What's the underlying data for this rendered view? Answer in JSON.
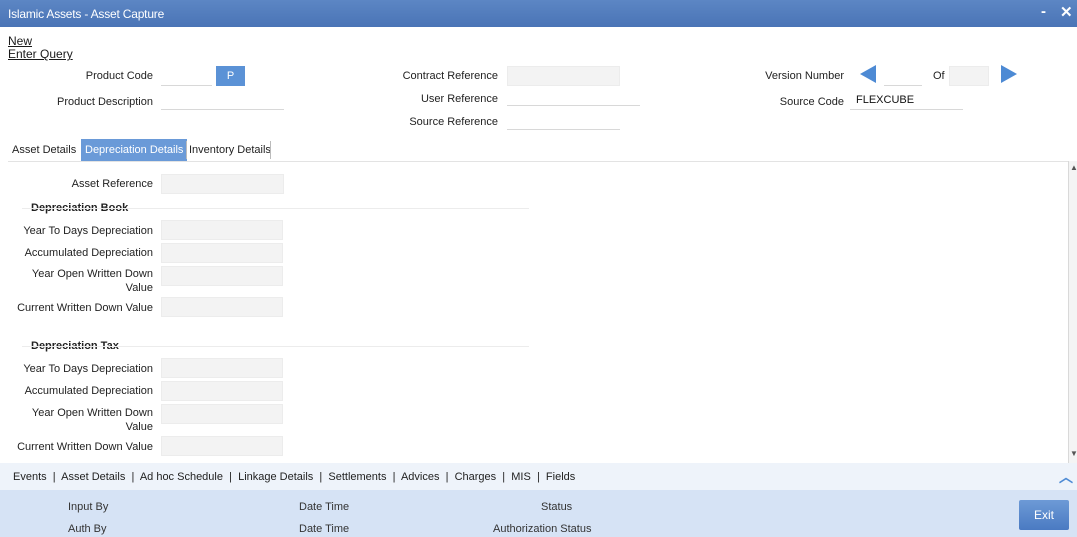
{
  "window": {
    "title": "Islamic Assets - Asset Capture",
    "minimize": "-",
    "close": "✕"
  },
  "menu": {
    "new": "New",
    "enter_query": "Enter Query"
  },
  "header": {
    "product_code_label": "Product Code",
    "product_code_value": "",
    "p_button": "P",
    "product_description_label": "Product Description",
    "product_description_value": "",
    "contract_reference_label": "Contract Reference",
    "contract_reference_value": "",
    "user_reference_label": "User Reference",
    "user_reference_value": "",
    "source_reference_label": "Source Reference",
    "source_reference_value": "",
    "version_number_label": "Version Number",
    "version_number_value": "",
    "of_label": "Of",
    "of_value": "",
    "source_code_label": "Source Code",
    "source_code_value": "FLEXCUBE"
  },
  "tabs": [
    {
      "label": "Asset Details",
      "active": false
    },
    {
      "label": "Depreciation Details",
      "active": true
    },
    {
      "label": "Inventory Details",
      "active": false
    }
  ],
  "depreciation": {
    "asset_reference_label": "Asset Reference",
    "book": {
      "title": "Depreciation Book",
      "ytd_label": "Year To Days Depreciation",
      "accum_label": "Accumulated Depreciation",
      "yowdv_label_1": "Year Open Written Down",
      "yowdv_label_2": "Value",
      "cwdv_label": "Current Written Down Value"
    },
    "tax": {
      "title": "Depreciation Tax",
      "ytd_label": "Year To Days Depreciation",
      "accum_label": "Accumulated Depreciation",
      "yowdv_label_1": "Year Open Written Down",
      "yowdv_label_2": "Value",
      "cwdv_label": "Current Written Down Value"
    }
  },
  "bottom_links": [
    "Events",
    "Asset Details",
    "Ad hoc Schedule",
    "Linkage Details",
    "Settlements",
    "Advices",
    "Charges",
    "MIS",
    "Fields"
  ],
  "footer": {
    "input_by": "Input By",
    "auth_by": "Auth By",
    "date_time_1": "Date Time",
    "date_time_2": "Date Time",
    "status": "Status",
    "authorization_status": "Authorization Status",
    "exit": "Exit"
  },
  "colors": {
    "titlebar": "#4f79ba",
    "accent": "#4d8ad4",
    "footer": "#d6e3f5"
  }
}
